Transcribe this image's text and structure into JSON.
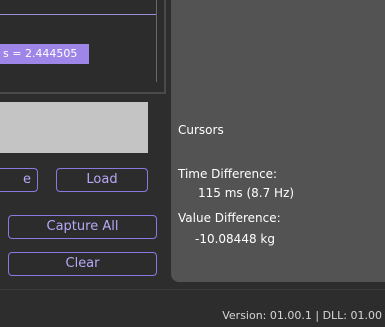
{
  "plot": {
    "readout_text": "s = 2.444505"
  },
  "buttons": {
    "save_label": "e",
    "load_label": "Load",
    "capture_all_label": "Capture All",
    "clear_label": "Clear"
  },
  "cursors": {
    "title": "Cursors",
    "time_difference_label": "Time Difference:",
    "time_difference_value": "115 ms (8.7 Hz)",
    "value_difference_label": "Value Difference:",
    "value_difference_value": "-10.08448 kg"
  },
  "footer": {
    "version_text": "Version: 01.00.1 | DLL: 01.00"
  },
  "colors": {
    "accent": "#9e86e8",
    "button_text": "#b8a8f8",
    "panel_bg": "#535353",
    "app_bg": "#2d2d2d"
  }
}
